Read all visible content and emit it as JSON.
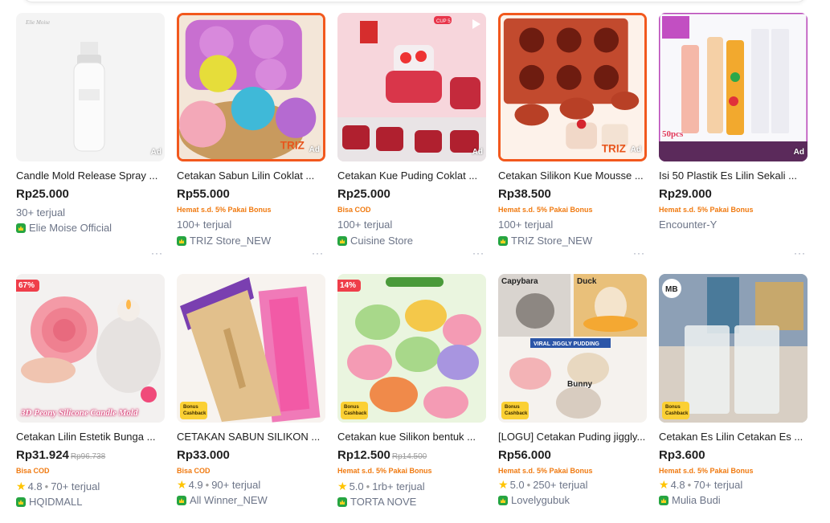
{
  "products": [
    {
      "title": "Candle Mold Release Spray ...",
      "price": "Rp25.000",
      "promo": "",
      "sold": "30+ terjual",
      "rating": "",
      "shop": "Elie Moise Official",
      "ad": "Ad",
      "discount": "",
      "cashback": ""
    },
    {
      "title": "Cetakan Sabun Lilin Coklat ...",
      "price": "Rp55.000",
      "promo": "Hemat s.d. 5% Pakai Bonus",
      "sold": "100+ terjual",
      "rating": "",
      "shop": "TRIZ Store_NEW",
      "ad": "Ad",
      "discount": "",
      "cashback": ""
    },
    {
      "title": "Cetakan Kue Puding Coklat ...",
      "price": "Rp25.000",
      "promo": "Bisa COD",
      "sold": "100+ terjual",
      "rating": "",
      "shop": "Cuisine Store",
      "ad": "Ad",
      "discount": "",
      "cashback": ""
    },
    {
      "title": "Cetakan Silikon Kue Mousse ...",
      "price": "Rp38.500",
      "promo": "Hemat s.d. 5% Pakai Bonus",
      "sold": "100+ terjual",
      "rating": "",
      "shop": "TRIZ Store_NEW",
      "ad": "Ad",
      "discount": "",
      "cashback": ""
    },
    {
      "title": "Isi 50 Plastik Es Lilin Sekali ...",
      "price": "Rp29.000",
      "promo": "Hemat s.d. 5% Pakai Bonus",
      "sold": "",
      "rating": "",
      "shop": "Encounter-Y",
      "ad": "Ad",
      "discount": "",
      "cashback": ""
    },
    {
      "title": "Cetakan Lilin Estetik Bunga ...",
      "price": "Rp31.924",
      "old_price": "Rp96.738",
      "promo": "Bisa COD",
      "sold": "70+ terjual",
      "rating": "4.8",
      "shop": "HQIDMALL",
      "ad": "",
      "discount": "67%",
      "cashback": ""
    },
    {
      "title": "CETAKAN SABUN SILIKON ...",
      "price": "Rp33.000",
      "promo": "Bisa COD",
      "sold": "90+ terjual",
      "rating": "4.9",
      "shop": "All Winner_NEW",
      "ad": "",
      "discount": "",
      "cashback": "Bonus Cashback"
    },
    {
      "title": "Cetakan kue Silikon bentuk ...",
      "price": "Rp12.500",
      "old_price": "Rp14.500",
      "promo": "Hemat s.d. 5% Pakai Bonus",
      "sold": "1rb+ terjual",
      "rating": "5.0",
      "shop": "TORTA NOVE",
      "ad": "",
      "discount": "14%",
      "cashback": "Bonus Cashback"
    },
    {
      "title": "[LOGU] Cetakan Puding jiggly...",
      "price": "Rp56.000",
      "promo": "Hemat s.d. 5% Pakai Bonus",
      "sold": "250+ terjual",
      "rating": "5.0",
      "shop": "Lovelygubuk",
      "ad": "",
      "discount": "",
      "cashback": "Bonus Cashback"
    },
    {
      "title": "Cetakan Es Lilin Cetakan Es ...",
      "price": "Rp3.600",
      "promo": "Hemat s.d. 5% Pakai Bonus",
      "sold": "70+ terjual",
      "rating": "4.8",
      "shop": "Mulia Budi",
      "ad": "",
      "discount": "",
      "cashback": "Bonus Cashback"
    }
  ],
  "image_text": {
    "triz_logo": "TRIZ",
    "cup_badge": "CUP 5",
    "peony_caption": "3D Peony Silicone Candle Mold",
    "encounter_tag": "50pcs",
    "capybara": "Capybara",
    "duck": "Duck",
    "viral": "VIRAL JIGGLY PUDDING",
    "bunny": "Bunny",
    "mb_logo": "MB"
  },
  "more_label": "···",
  "colors": {
    "accent": "#f2581d",
    "promo": "#f07a10",
    "star": "#ffc400",
    "badge_green": "#26a541",
    "discount": "#ef3e4a"
  }
}
